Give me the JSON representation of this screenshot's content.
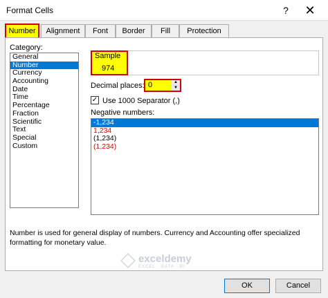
{
  "window": {
    "title": "Format Cells",
    "help_glyph": "?",
    "close_glyph": "✕"
  },
  "tabs": [
    {
      "label": "Number"
    },
    {
      "label": "Alignment"
    },
    {
      "label": "Font"
    },
    {
      "label": "Border"
    },
    {
      "label": "Fill"
    },
    {
      "label": "Protection"
    }
  ],
  "category": {
    "label": "Category:",
    "items": [
      "General",
      "Number",
      "Currency",
      "Accounting",
      "Date",
      "Time",
      "Percentage",
      "Fraction",
      "Scientific",
      "Text",
      "Special",
      "Custom"
    ],
    "selected": "Number"
  },
  "sample": {
    "label": "Sample",
    "value": "974"
  },
  "decimal": {
    "label": "Decimal places:",
    "value": "0"
  },
  "separator": {
    "label": "Use 1000 Separator (,)",
    "checked": true
  },
  "negative": {
    "label": "Negative numbers:",
    "items": [
      "-1,234",
      "1,234",
      "(1,234)",
      "(1,234)"
    ],
    "red_color": "#e00000"
  },
  "description": "Number is used for general display of numbers.  Currency and Accounting offer specialized formatting for monetary value.",
  "watermark": {
    "name": "exceldemy",
    "tagline": "EXCEL · DATA · BI"
  },
  "buttons": {
    "ok": "OK",
    "cancel": "Cancel"
  },
  "colors": {
    "highlight": "#ffff00",
    "outline": "#d10000",
    "selection": "#0078d7"
  }
}
